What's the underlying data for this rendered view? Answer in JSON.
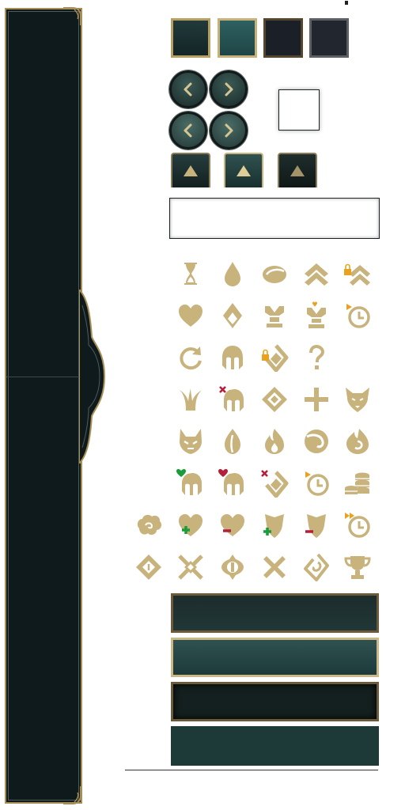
{
  "colors": {
    "gold": "#c8b37d",
    "dark": "#0f1a1d",
    "teal": "#1e3a38",
    "green": "#1a9c3a",
    "red": "#b2203a",
    "orange": "#e8a21f"
  },
  "arrow_buttons": [
    {
      "name": "prev-button-dark",
      "icon": "chevron-left-icon"
    },
    {
      "name": "next-button-dark",
      "icon": "chevron-right-icon"
    },
    {
      "name": "prev-button-teal",
      "icon": "chevron-left-icon"
    },
    {
      "name": "next-button-teal",
      "icon": "chevron-right-icon"
    }
  ],
  "up_buttons": [
    "caret-up-icon",
    "caret-up-icon",
    "caret-up-icon"
  ],
  "textbox": {
    "value": ""
  },
  "icons": [
    [
      "hourglass-icon",
      "droplet-icon",
      "stone-icon",
      "double-chevron-up-icon",
      "locked-double-chevron-icon"
    ],
    [
      "heart-icon",
      "diamond-drop-icon",
      "champion-pedestal-icon",
      "champion-pedestal-upgrade-icon",
      "cooldown-clock-icon"
    ],
    [
      "refresh-icon",
      "helmet-icon",
      "locked-diamond-icon",
      "question-mark-icon",
      ""
    ],
    [
      "claw-icon",
      "helmet-removed-icon",
      "target-diamond-icon",
      "plus-icon",
      "wolf-head-icon"
    ],
    [
      "demon-mask-icon",
      "flame-leaf-icon",
      "fire-icon",
      "swirl-icon",
      "spiral-flame-icon"
    ],
    [
      "helmet-heal-icon",
      "helmet-damage-icon",
      "diamond-removed-icon",
      "clock-play-icon",
      "gold-coins-icon"
    ],
    [
      "cloud-swirl-icon",
      "heart-plus-icon",
      "heart-minus-icon",
      "shield-plus-icon",
      "shield-minus-icon",
      "clock-fast-forward-icon"
    ],
    [
      "diamond-rune-icon",
      "crossed-blades-icon",
      "eye-sigil-icon",
      "cross-x-icon",
      "rune-spiral-icon",
      "trophy-icon"
    ]
  ]
}
